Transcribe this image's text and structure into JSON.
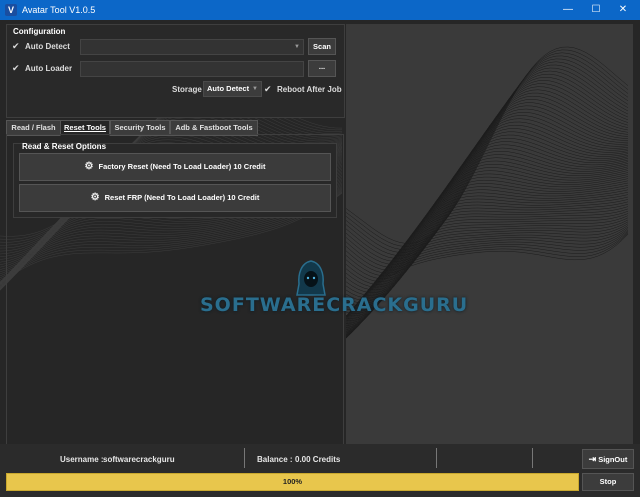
{
  "window": {
    "title": "Avatar Tool V1.0.5",
    "app_icon": "V",
    "minimize": "—",
    "maximize": "☐",
    "close": "✕"
  },
  "config": {
    "title": "Configuration",
    "auto_detect_label": "Auto Detect",
    "auto_detect_checked": true,
    "auto_detect_value": "",
    "scan_label": "Scan",
    "auto_loader_label": "Auto Loader",
    "auto_loader_checked": true,
    "auto_loader_value": "",
    "browse_label": "...",
    "storage_label": "Storage",
    "storage_value": "Auto Detect",
    "reboot_label": "Reboot After Job",
    "reboot_checked": true
  },
  "tabs": [
    {
      "label": "Read / Flash",
      "active": false
    },
    {
      "label": "Reset Tools",
      "active": true
    },
    {
      "label": "Security Tools",
      "active": false
    },
    {
      "label": "Adb & Fastboot Tools",
      "active": false
    }
  ],
  "reset": {
    "group_title": "Read & Reset Options",
    "factory_reset_label": "Factory Reset (Need To Load Loader) 10 Credit",
    "reset_frp_label": "Reset FRP (Need To Load Loader) 10 Credit"
  },
  "watermark": "SOFTWARECRACKGURU",
  "status": {
    "username_label": "Username :",
    "username_value": "softwarecrackguru",
    "balance_label": "Balance :",
    "balance_value": "0.00 Credits",
    "signout_label": "SignOut",
    "progress_text": "100%",
    "progress_fraction": 1.0,
    "stop_label": "Stop"
  },
  "colors": {
    "titlebar": "#0c67c8",
    "progress": "#e2c24d",
    "watermark": "#2a6e8e"
  }
}
